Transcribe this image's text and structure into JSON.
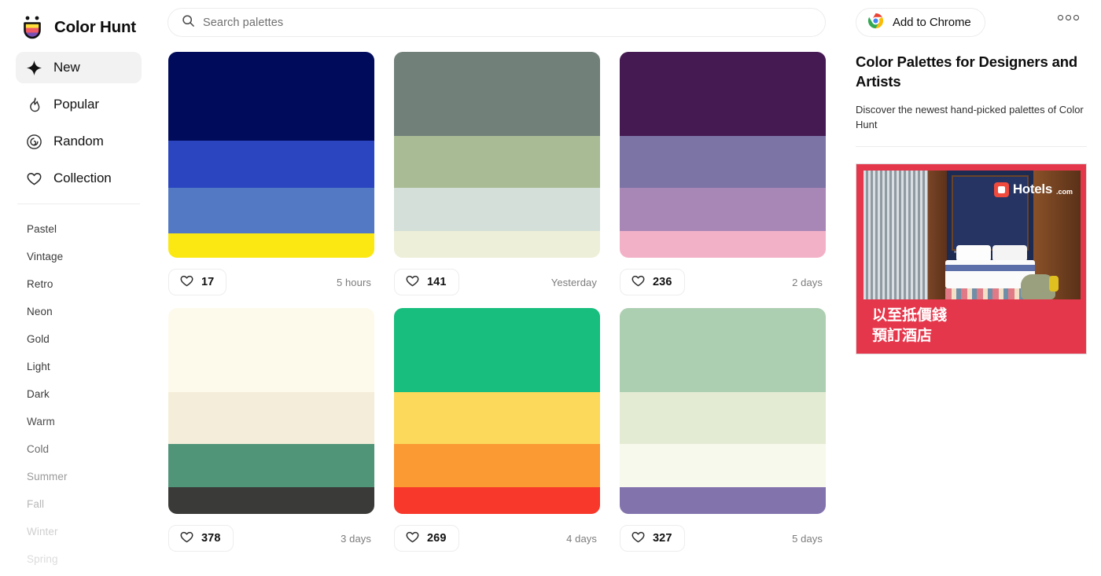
{
  "brand": {
    "name": "Color Hunt",
    "logo_icon": "colorhunt-smiley-logo"
  },
  "search": {
    "placeholder": "Search palettes",
    "value": "",
    "icon": "search-icon"
  },
  "topbar": {
    "chrome_label": "Add to Chrome",
    "chrome_icon": "chrome-logo-icon",
    "menu_icon": "three-dots-menu-icon"
  },
  "sidebar": {
    "nav": [
      {
        "label": "New",
        "icon": "sparkle-star-icon",
        "active": true
      },
      {
        "label": "Popular",
        "icon": "flame-icon",
        "active": false
      },
      {
        "label": "Random",
        "icon": "spiral-icon",
        "active": false
      },
      {
        "label": "Collection",
        "icon": "heart-outline-icon",
        "active": false
      }
    ],
    "tags": [
      {
        "label": "Pastel",
        "color": "#3a3a3a"
      },
      {
        "label": "Vintage",
        "color": "#3a3a3a"
      },
      {
        "label": "Retro",
        "color": "#3a3a3a"
      },
      {
        "label": "Neon",
        "color": "#3a3a3a"
      },
      {
        "label": "Gold",
        "color": "#3a3a3a"
      },
      {
        "label": "Light",
        "color": "#3a3a3a"
      },
      {
        "label": "Dark",
        "color": "#3a3a3a"
      },
      {
        "label": "Warm",
        "color": "#4a4a4a"
      },
      {
        "label": "Cold",
        "color": "#6b6b6b"
      },
      {
        "label": "Summer",
        "color": "#9a9a9a"
      },
      {
        "label": "Fall",
        "color": "#b8b8b8"
      },
      {
        "label": "Winter",
        "color": "#cfcfcf"
      },
      {
        "label": "Spring",
        "color": "#dcdcdc"
      }
    ]
  },
  "palettes": [
    {
      "colors": [
        "#000B5B",
        "#2A45BF",
        "#5379C4",
        "#FBE812"
      ],
      "heights": [
        43,
        23,
        22,
        12
      ],
      "likes": "17",
      "time": "5 hours"
    },
    {
      "colors": [
        "#72807A",
        "#A8BB95",
        "#D3DFD8",
        "#EEEFD8"
      ],
      "heights": [
        41,
        25,
        21,
        13
      ],
      "likes": "141",
      "time": "Yesterday"
    },
    {
      "colors": [
        "#451952",
        "#7B74A4",
        "#A886B6",
        "#F3B1C8"
      ],
      "heights": [
        41,
        25,
        21,
        13
      ],
      "likes": "236",
      "time": "2 days"
    },
    {
      "colors": [
        "#FDFAEC",
        "#F3EDD9",
        "#519579",
        "#3A3A38"
      ],
      "heights": [
        41,
        25,
        21,
        13
      ],
      "likes": "378",
      "time": "3 days"
    },
    {
      "colors": [
        "#17BE7D",
        "#FCD95B",
        "#FB9A32",
        "#F7382B"
      ],
      "heights": [
        41,
        25,
        21,
        13
      ],
      "likes": "269",
      "time": "4 days"
    },
    {
      "colors": [
        "#ACCFB1",
        "#E4EBD3",
        "#F7F9EC",
        "#8373AD"
      ],
      "heights": [
        41,
        25,
        21,
        13
      ],
      "likes": "327",
      "time": "5 days"
    }
  ],
  "right_panel": {
    "title": "Color Palettes for Designers and Artists",
    "subtitle": "Discover the newest hand-picked palettes of Color Hunt"
  },
  "ad": {
    "logo_text": "Hotels",
    "logo_tld": ".com",
    "caption_line1": "以至抵價錢",
    "caption_line2": "預訂酒店",
    "background_color": "#e5374b"
  }
}
